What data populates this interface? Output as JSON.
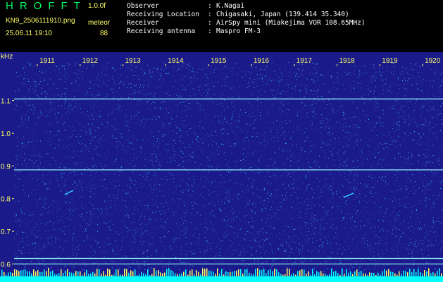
{
  "header": {
    "app_title": "HROFFT",
    "version": "1.0.0f",
    "filename": "KN9_2506111910.png",
    "mode": "meteor",
    "datetime": "25.06.11 19:10",
    "count": "88"
  },
  "info": [
    {
      "key": "Observer",
      "value": "K.Nagai"
    },
    {
      "key": "Receiving Location",
      "value": "Chigasaki, Japan (139.414 35.340)"
    },
    {
      "key": "Receiver",
      "value": "AirSpy mini (Miakejima VOR 108.65MHz)"
    },
    {
      "key": "Receiving antenna",
      "value": "Maspro FM-3"
    }
  ],
  "separator": ":",
  "waterfall": {
    "unit": "kHz",
    "y_ticks": [
      "1.1",
      "1.0",
      "0.9",
      "0.8",
      "0.7",
      "0.6"
    ],
    "y_tick_values": [
      1.1,
      1.0,
      0.9,
      0.8,
      0.7,
      0.6
    ],
    "x_ticks": [
      "1911",
      "1912",
      "1913",
      "1914",
      "1915",
      "1916",
      "1917",
      "1918",
      "1919",
      "1920"
    ],
    "y_range": [
      0.575,
      1.205
    ],
    "carrier_lines_khz": [
      1.105,
      0.888,
      0.617,
      0.6
    ],
    "colors": {
      "background": "#1a1a8a",
      "noise_high": "#33ccff",
      "noise_low": "#3355cc",
      "carrier": "#99ffff",
      "baseline": "#00ffff",
      "tick": "#ffff66"
    }
  }
}
